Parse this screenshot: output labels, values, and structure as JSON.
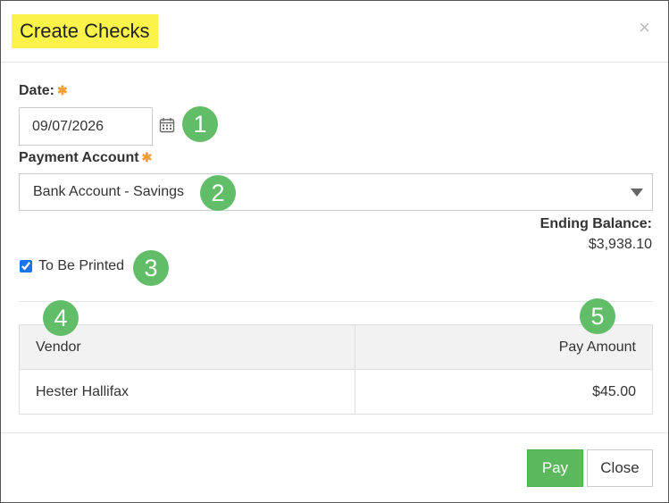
{
  "dialog": {
    "title": "Create Checks",
    "close_glyph": "×"
  },
  "form": {
    "date_label": "Date:",
    "date_required": "✱",
    "date_value": "09/07/2026",
    "payment_account_label": "Payment Account",
    "payment_account_required": "✱",
    "payment_account_value": "Bank Account - Savings",
    "ending_balance_label": "Ending Balance:",
    "ending_balance_value": "$3,938.10",
    "to_be_printed_label": "To Be Printed",
    "to_be_printed_checked": true
  },
  "table": {
    "columns": [
      "Vendor",
      "Pay Amount"
    ],
    "rows": [
      {
        "vendor": "Hester Hallifax",
        "amount": "$45.00"
      }
    ]
  },
  "badges": [
    "1",
    "2",
    "3",
    "4",
    "5"
  ],
  "footer": {
    "pay_label": "Pay",
    "close_label": "Close"
  },
  "colors": {
    "title_highlight": "#fbf34a",
    "badge": "#62bd69",
    "required": "#f0a030",
    "pay_button": "#5cb85c"
  },
  "icons": {
    "date_picker": "calendar-icon",
    "select_caret": "caret-down-icon",
    "dismiss": "close-icon"
  }
}
